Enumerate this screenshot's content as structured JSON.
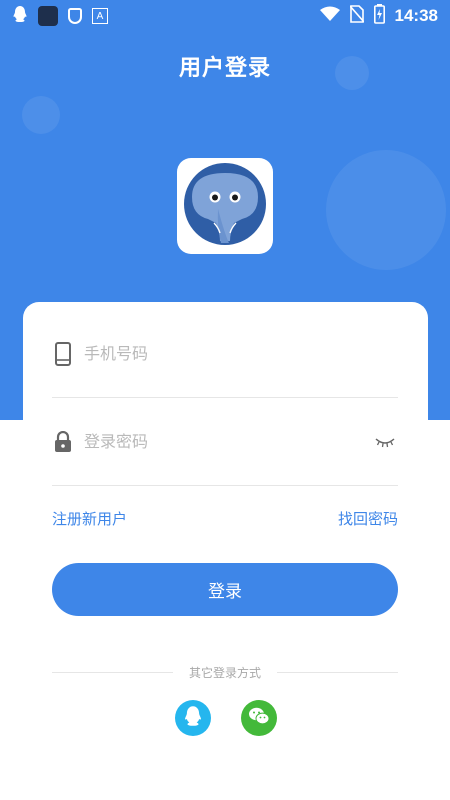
{
  "status_bar": {
    "time": "14:38",
    "icons": [
      "qq-notification-icon",
      "app-icon",
      "shield-icon",
      "a-icon",
      "wifi-icon",
      "no-sim-icon",
      "battery-icon"
    ]
  },
  "header": {
    "title": "用户登录"
  },
  "logo": {
    "name": "elephant-logo-icon"
  },
  "form": {
    "phone_placeholder": "手机号码",
    "phone_value": "",
    "password_placeholder": "登录密码",
    "password_value": ""
  },
  "links": {
    "register": "注册新用户",
    "forgot": "找回密码"
  },
  "login_button": "登录",
  "other_login": {
    "label": "其它登录方式",
    "options": [
      "qq-icon",
      "wechat-icon"
    ]
  },
  "colors": {
    "primary": "#3e86e8",
    "qq": "#25b6ee",
    "wechat": "#43b93a"
  }
}
